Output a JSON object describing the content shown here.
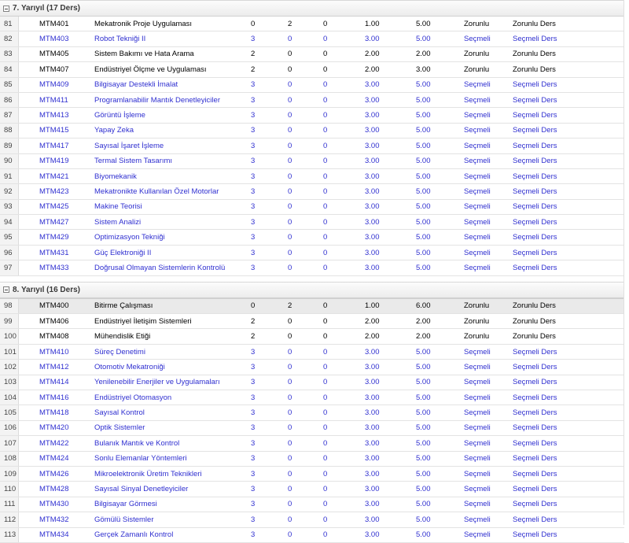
{
  "semester7": {
    "title": "7. Yarıyıl (17 Ders)",
    "rows": [
      {
        "no": "81",
        "code": "MTM401",
        "name": "Mekatronik Proje Uygulaması",
        "t": "0",
        "u": "2",
        "l": "0",
        "credit": "1.00",
        "ects": "5.00",
        "type": "Zorunlu",
        "group": "Zorunlu Ders",
        "link": false
      },
      {
        "no": "82",
        "code": "MTM403",
        "name": "Robot Tekniği II",
        "t": "3",
        "u": "0",
        "l": "0",
        "credit": "3.00",
        "ects": "5.00",
        "type": "Seçmeli",
        "group": "Seçmeli Ders",
        "link": true
      },
      {
        "no": "83",
        "code": "MTM405",
        "name": "Sistem Bakımı ve Hata Arama",
        "t": "2",
        "u": "0",
        "l": "0",
        "credit": "2.00",
        "ects": "2.00",
        "type": "Zorunlu",
        "group": "Zorunlu Ders",
        "link": false
      },
      {
        "no": "84",
        "code": "MTM407",
        "name": "Endüstriyel Ölçme ve Uygulaması",
        "t": "2",
        "u": "0",
        "l": "0",
        "credit": "2.00",
        "ects": "3.00",
        "type": "Zorunlu",
        "group": "Zorunlu Ders",
        "link": false
      },
      {
        "no": "85",
        "code": "MTM409",
        "name": "Bilgisayar Destekli İmalat",
        "t": "3",
        "u": "0",
        "l": "0",
        "credit": "3.00",
        "ects": "5.00",
        "type": "Seçmeli",
        "group": "Seçmeli Ders",
        "link": true
      },
      {
        "no": "86",
        "code": "MTM411",
        "name": "Programlanabilir Mantık Denetleyiciler",
        "t": "3",
        "u": "0",
        "l": "0",
        "credit": "3.00",
        "ects": "5.00",
        "type": "Seçmeli",
        "group": "Seçmeli Ders",
        "link": true
      },
      {
        "no": "87",
        "code": "MTM413",
        "name": "Görüntü İşleme",
        "t": "3",
        "u": "0",
        "l": "0",
        "credit": "3.00",
        "ects": "5.00",
        "type": "Seçmeli",
        "group": "Seçmeli Ders",
        "link": true
      },
      {
        "no": "88",
        "code": "MTM415",
        "name": "Yapay Zeka",
        "t": "3",
        "u": "0",
        "l": "0",
        "credit": "3.00",
        "ects": "5.00",
        "type": "Seçmeli",
        "group": "Seçmeli Ders",
        "link": true
      },
      {
        "no": "89",
        "code": "MTM417",
        "name": "Sayısal İşaret İşleme",
        "t": "3",
        "u": "0",
        "l": "0",
        "credit": "3.00",
        "ects": "5.00",
        "type": "Seçmeli",
        "group": "Seçmeli Ders",
        "link": true
      },
      {
        "no": "90",
        "code": "MTM419",
        "name": "Termal Sistem Tasarımı",
        "t": "3",
        "u": "0",
        "l": "0",
        "credit": "3.00",
        "ects": "5.00",
        "type": "Seçmeli",
        "group": "Seçmeli Ders",
        "link": true
      },
      {
        "no": "91",
        "code": "MTM421",
        "name": "Biyomekanik",
        "t": "3",
        "u": "0",
        "l": "0",
        "credit": "3.00",
        "ects": "5.00",
        "type": "Seçmeli",
        "group": "Seçmeli Ders",
        "link": true
      },
      {
        "no": "92",
        "code": "MTM423",
        "name": "Mekatronikte Kullanılan Özel Motorlar",
        "t": "3",
        "u": "0",
        "l": "0",
        "credit": "3.00",
        "ects": "5.00",
        "type": "Seçmeli",
        "group": "Seçmeli Ders",
        "link": true
      },
      {
        "no": "93",
        "code": "MTM425",
        "name": "Makine Teorisi",
        "t": "3",
        "u": "0",
        "l": "0",
        "credit": "3.00",
        "ects": "5.00",
        "type": "Seçmeli",
        "group": "Seçmeli Ders",
        "link": true
      },
      {
        "no": "94",
        "code": "MTM427",
        "name": "Sistem Analizi",
        "t": "3",
        "u": "0",
        "l": "0",
        "credit": "3.00",
        "ects": "5.00",
        "type": "Seçmeli",
        "group": "Seçmeli Ders",
        "link": true
      },
      {
        "no": "95",
        "code": "MTM429",
        "name": "Optimizasyon Tekniği",
        "t": "3",
        "u": "0",
        "l": "0",
        "credit": "3.00",
        "ects": "5.00",
        "type": "Seçmeli",
        "group": "Seçmeli Ders",
        "link": true
      },
      {
        "no": "96",
        "code": "MTM431",
        "name": "Güç Elektroniği II",
        "t": "3",
        "u": "0",
        "l": "0",
        "credit": "3.00",
        "ects": "5.00",
        "type": "Seçmeli",
        "group": "Seçmeli Ders",
        "link": true
      },
      {
        "no": "97",
        "code": "MTM433",
        "name": "Doğrusal Olmayan Sistemlerin Kontrolü",
        "t": "3",
        "u": "0",
        "l": "0",
        "credit": "3.00",
        "ects": "5.00",
        "type": "Seçmeli",
        "group": "Seçmeli Ders",
        "link": true
      }
    ]
  },
  "semester8": {
    "title": "8. Yarıyıl (16 Ders)",
    "rows": [
      {
        "no": "98",
        "code": "MTM400",
        "name": "Bitirme Çalışması",
        "t": "0",
        "u": "2",
        "l": "0",
        "credit": "1.00",
        "ects": "6.00",
        "type": "Zorunlu",
        "group": "Zorunlu Ders",
        "link": false,
        "selected": true
      },
      {
        "no": "99",
        "code": "MTM406",
        "name": "Endüstriyel İletişim Sistemleri",
        "t": "2",
        "u": "0",
        "l": "0",
        "credit": "2.00",
        "ects": "2.00",
        "type": "Zorunlu",
        "group": "Zorunlu Ders",
        "link": false
      },
      {
        "no": "100",
        "code": "MTM408",
        "name": "Mühendislik Etiği",
        "t": "2",
        "u": "0",
        "l": "0",
        "credit": "2.00",
        "ects": "2.00",
        "type": "Zorunlu",
        "group": "Zorunlu Ders",
        "link": false
      },
      {
        "no": "101",
        "code": "MTM410",
        "name": "Süreç Denetimi",
        "t": "3",
        "u": "0",
        "l": "0",
        "credit": "3.00",
        "ects": "5.00",
        "type": "Seçmeli",
        "group": "Seçmeli Ders",
        "link": true
      },
      {
        "no": "102",
        "code": "MTM412",
        "name": "Otomotiv Mekatroniği",
        "t": "3",
        "u": "0",
        "l": "0",
        "credit": "3.00",
        "ects": "5.00",
        "type": "Seçmeli",
        "group": "Seçmeli Ders",
        "link": true
      },
      {
        "no": "103",
        "code": "MTM414",
        "name": "Yenilenebilir Enerjiler ve Uygulamaları",
        "t": "3",
        "u": "0",
        "l": "0",
        "credit": "3.00",
        "ects": "5.00",
        "type": "Seçmeli",
        "group": "Seçmeli Ders",
        "link": true
      },
      {
        "no": "104",
        "code": "MTM416",
        "name": "Endüstriyel Otomasyon",
        "t": "3",
        "u": "0",
        "l": "0",
        "credit": "3.00",
        "ects": "5.00",
        "type": "Seçmeli",
        "group": "Seçmeli Ders",
        "link": true
      },
      {
        "no": "105",
        "code": "MTM418",
        "name": "Sayısal Kontrol",
        "t": "3",
        "u": "0",
        "l": "0",
        "credit": "3.00",
        "ects": "5.00",
        "type": "Seçmeli",
        "group": "Seçmeli Ders",
        "link": true
      },
      {
        "no": "106",
        "code": "MTM420",
        "name": "Optik Sistemler",
        "t": "3",
        "u": "0",
        "l": "0",
        "credit": "3.00",
        "ects": "5.00",
        "type": "Seçmeli",
        "group": "Seçmeli Ders",
        "link": true
      },
      {
        "no": "107",
        "code": "MTM422",
        "name": "Bulanık Mantık ve Kontrol",
        "t": "3",
        "u": "0",
        "l": "0",
        "credit": "3.00",
        "ects": "5.00",
        "type": "Seçmeli",
        "group": "Seçmeli Ders",
        "link": true
      },
      {
        "no": "108",
        "code": "MTM424",
        "name": "Sonlu Elemanlar Yöntemleri",
        "t": "3",
        "u": "0",
        "l": "0",
        "credit": "3.00",
        "ects": "5.00",
        "type": "Seçmeli",
        "group": "Seçmeli Ders",
        "link": true
      },
      {
        "no": "109",
        "code": "MTM426",
        "name": "Mikroelektronik Üretim Teknikleri",
        "t": "3",
        "u": "0",
        "l": "0",
        "credit": "3.00",
        "ects": "5.00",
        "type": "Seçmeli",
        "group": "Seçmeli Ders",
        "link": true
      },
      {
        "no": "110",
        "code": "MTM428",
        "name": "Sayısal Sinyal Denetleyiciler",
        "t": "3",
        "u": "0",
        "l": "0",
        "credit": "3.00",
        "ects": "5.00",
        "type": "Seçmeli",
        "group": "Seçmeli Ders",
        "link": true
      },
      {
        "no": "111",
        "code": "MTM430",
        "name": "Bilgisayar Görmesi",
        "t": "3",
        "u": "0",
        "l": "0",
        "credit": "3.00",
        "ects": "5.00",
        "type": "Seçmeli",
        "group": "Seçmeli Ders",
        "link": true
      },
      {
        "no": "112",
        "code": "MTM432",
        "name": "Gömülü Sistemler",
        "t": "3",
        "u": "0",
        "l": "0",
        "credit": "3.00",
        "ects": "5.00",
        "type": "Seçmeli",
        "group": "Seçmeli Ders",
        "link": true
      },
      {
        "no": "113",
        "code": "MTM434",
        "name": "Gerçek Zamanlı Kontrol",
        "t": "3",
        "u": "0",
        "l": "0",
        "credit": "3.00",
        "ects": "5.00",
        "type": "Seçmeli",
        "group": "Seçmeli Ders",
        "link": true
      }
    ]
  },
  "colors": {
    "link": "#2f2fd0",
    "text": "#000000",
    "header_text": "#3a3a3a"
  }
}
